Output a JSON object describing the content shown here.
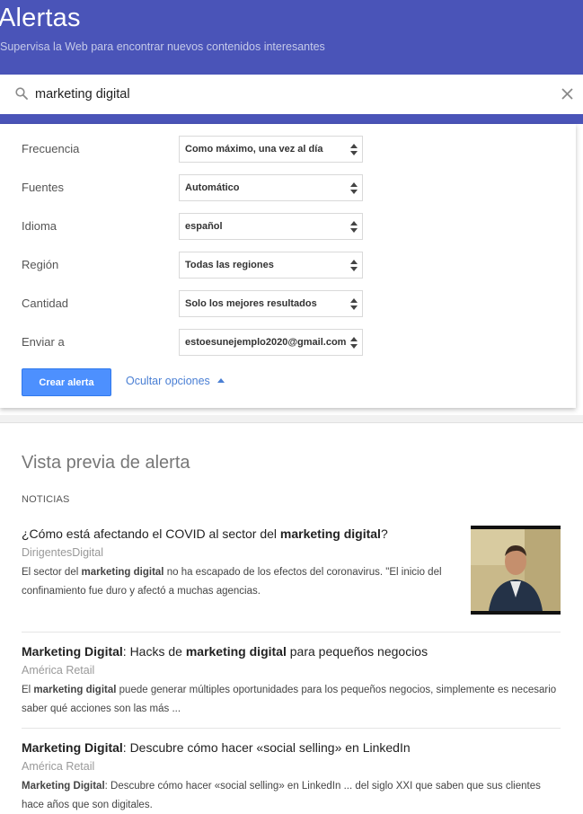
{
  "header": {
    "title": "Alertas",
    "subtitle": "Supervisa la Web para encontrar nuevos contenidos interesantes"
  },
  "search": {
    "value": "marketing digital"
  },
  "options": [
    {
      "label": "Frecuencia",
      "value": "Como máximo, una vez al día"
    },
    {
      "label": "Fuentes",
      "value": "Automático"
    },
    {
      "label": "Idioma",
      "value": "español"
    },
    {
      "label": "Región",
      "value": "Todas las regiones"
    },
    {
      "label": "Cantidad",
      "value": "Solo los mejores resultados"
    },
    {
      "label": "Enviar a",
      "value": "estoesunejemplo2020@gmail.com"
    }
  ],
  "actions": {
    "create_label": "Crear alerta",
    "hide_options_label": "Ocultar opciones"
  },
  "preview": {
    "title": "Vista previa de alerta",
    "section": "NOTICIAS",
    "articles": [
      {
        "title_parts": [
          "¿Cómo está afectando el COVID al sector del ",
          "marketing digital",
          "?"
        ],
        "source": "DirigentesDigital",
        "snippet_parts": [
          "El sector del ",
          "marketing digital",
          " no ha escapado de los efectos del coronavirus. \"El inicio del confinamiento fue duro y afectó a muchas agencias."
        ]
      },
      {
        "title_parts": [
          "Marketing Digital",
          ": Hacks de ",
          "marketing digital",
          " para pequeños negocios"
        ],
        "source": "América Retail",
        "snippet_parts": [
          "El ",
          "marketing digital",
          " puede generar múltiples oportunidades para los pequeños negocios, simplemente es necesario saber qué acciones son las más ..."
        ]
      },
      {
        "title_parts": [
          "Marketing Digital",
          ": Descubre cómo hacer «social selling» en LinkedIn"
        ],
        "source": "América Retail",
        "snippet_parts": [
          "Marketing Digital",
          ": Descubre cómo hacer «social selling» en LinkedIn ... del siglo XXI que saben que sus clientes hace años que son digitales."
        ]
      }
    ]
  },
  "colors": {
    "header_bg": "#4a54b8",
    "accent_button": "#4d90fe",
    "link": "#4a7fd4"
  }
}
